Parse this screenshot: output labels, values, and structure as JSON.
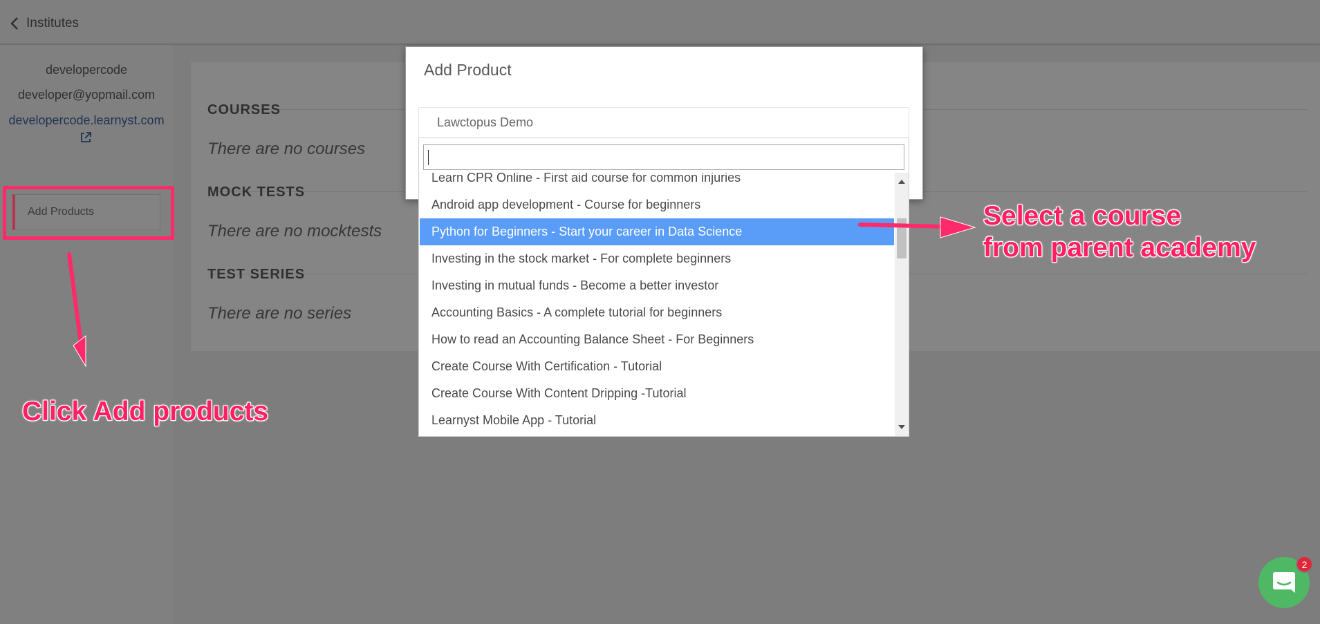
{
  "topbar": {
    "back_label": "Institutes"
  },
  "sidebar": {
    "name": "developercode",
    "email": "developer@yopmail.com",
    "site": "developercode.learnyst.com",
    "add_products_label": "Add Products"
  },
  "main": {
    "sections": [
      {
        "title": "COURSES",
        "empty": "There are no courses"
      },
      {
        "title": "MOCK TESTS",
        "empty": "There are no mocktests"
      },
      {
        "title": "TEST SERIES",
        "empty": "There are no series"
      }
    ]
  },
  "modal": {
    "title": "Add Product",
    "selected_value": "Lawctopus Demo",
    "search_value": "",
    "options": [
      "Learn CPR Online - First aid course for common injuries",
      "Android app development - Course for beginners",
      "Python for Beginners - Start your career in Data Science",
      "Investing in the stock market - For complete beginners",
      "Investing in mutual funds - Become a better investor",
      "Accounting Basics - A complete tutorial for beginners",
      "How to read an Accounting Balance Sheet - For Beginners",
      "Create Course With Certification - Tutorial",
      "Create Course With Content Dripping -Tutorial",
      "Learnyst Mobile App - Tutorial"
    ],
    "highlighted_index": 2
  },
  "annotations": {
    "click_add": "Click Add products",
    "select_course_line1": "Select a course",
    "select_course_line2": "from parent academy"
  },
  "chat": {
    "badge_count": "2"
  },
  "colors": {
    "accent_annotation": "#ff1f63",
    "option_highlight": "#5a9df8",
    "chat_green": "#4fb865",
    "badge_red": "#e0263a"
  }
}
